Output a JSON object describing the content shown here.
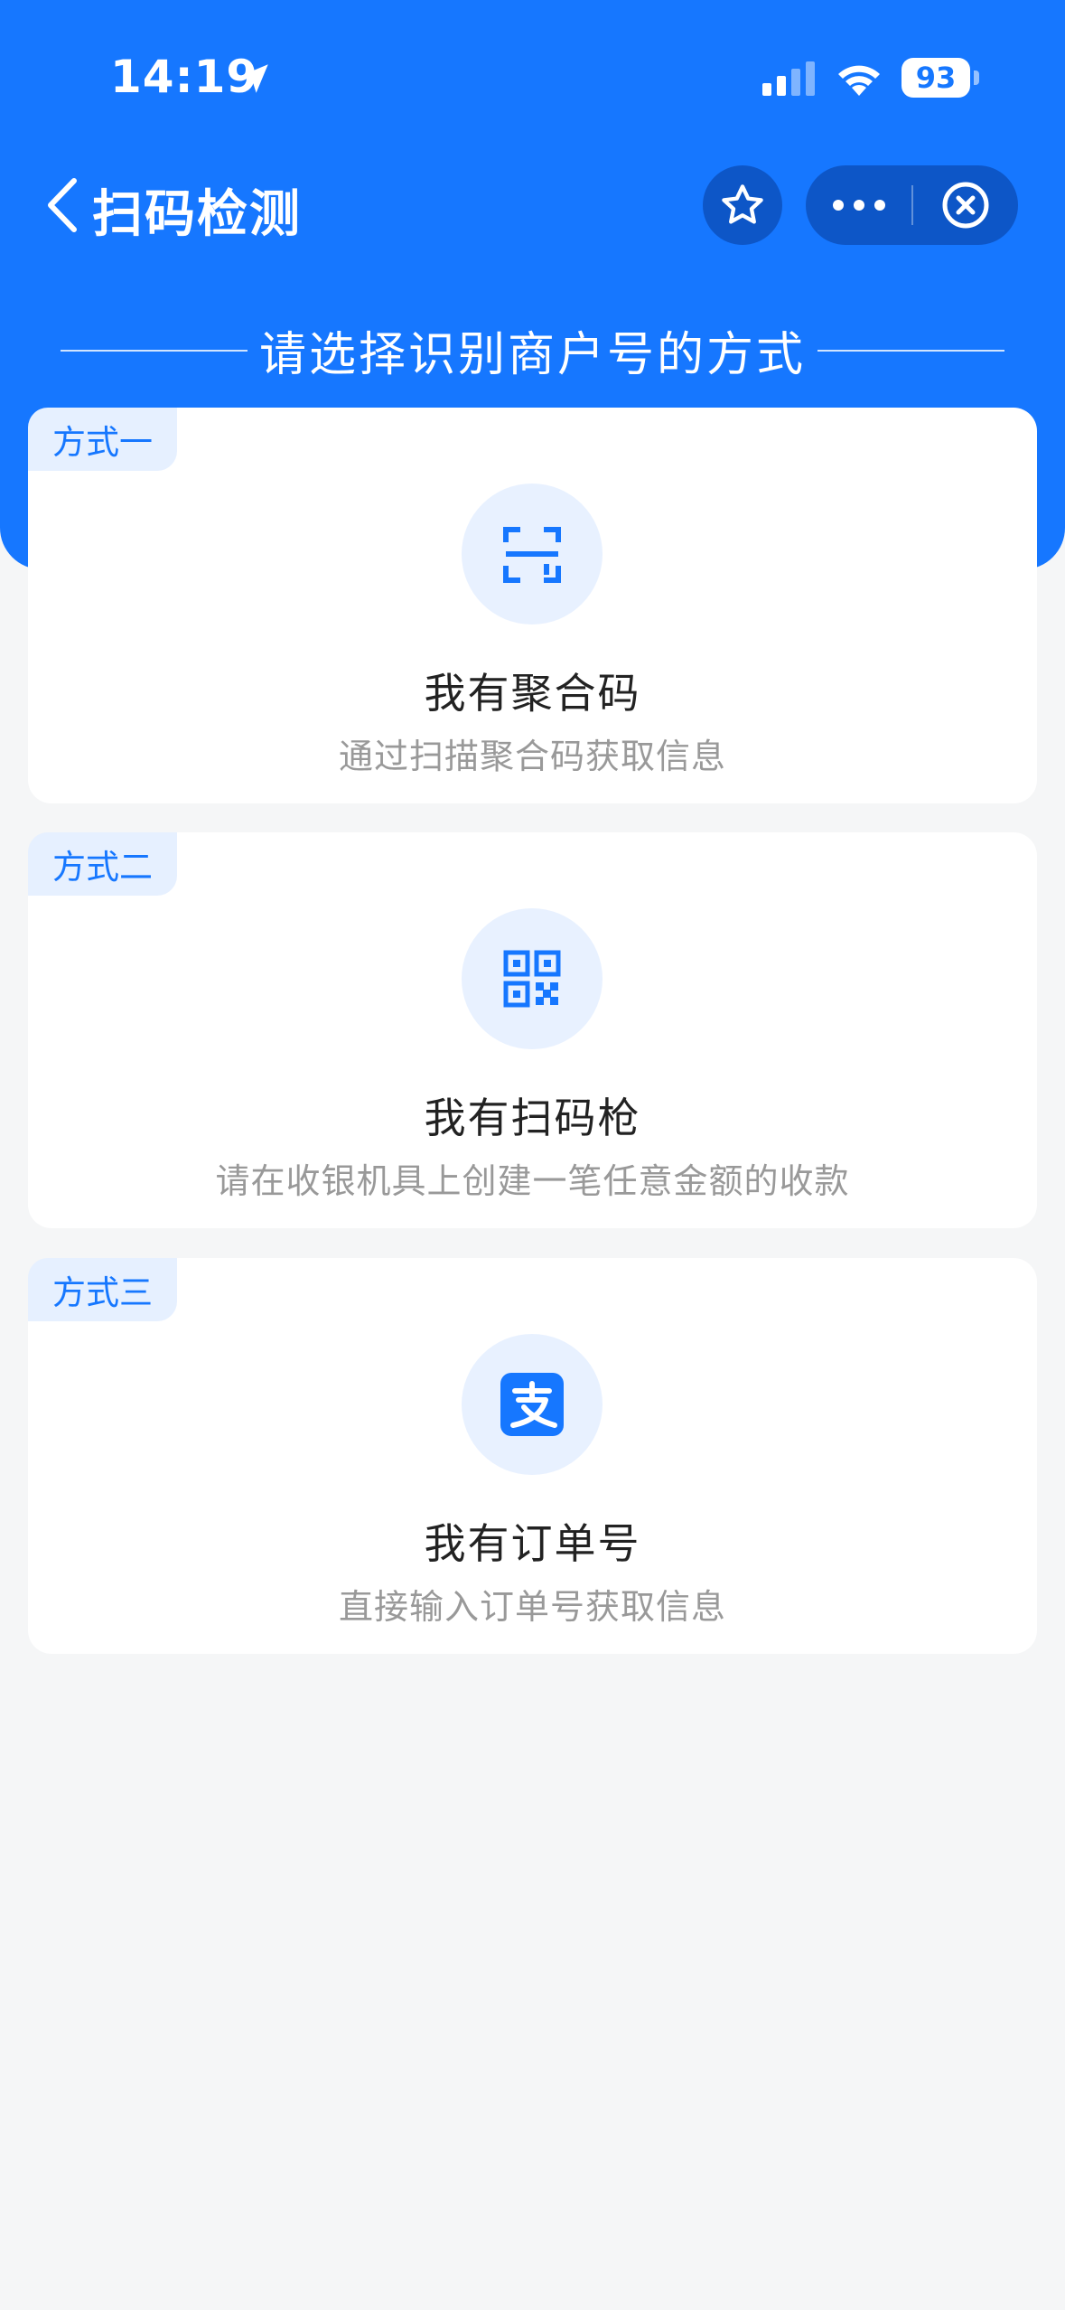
{
  "status_bar": {
    "time": "14:19",
    "battery": "93",
    "icons": [
      "location-arrow-icon",
      "cellular-signal-icon",
      "wifi-icon",
      "battery-icon"
    ]
  },
  "nav": {
    "title": "扫码检测",
    "icons": [
      "back-chevron-icon",
      "star-icon",
      "more-dots-icon",
      "close-circle-icon"
    ]
  },
  "heading": "请选择识别商户号的方式",
  "options": [
    {
      "tag": "方式一",
      "title": "我有聚合码",
      "desc": "通过扫描聚合码获取信息",
      "icon": "scan-frame-icon"
    },
    {
      "tag": "方式二",
      "title": "我有扫码枪",
      "desc": "请在收银机具上创建一笔任意金额的收款",
      "icon": "qr-code-icon"
    },
    {
      "tag": "方式三",
      "title": "我有订单号",
      "desc": "直接输入订单号获取信息",
      "icon": "alipay-icon"
    }
  ],
  "colors": {
    "primary": "#1677ff",
    "primary_dark": "#0d56c7",
    "tag_bg": "#e6f0ff",
    "icon_bg": "#e8f1ff",
    "page_bg": "#f5f6f7",
    "title_text": "#222222",
    "desc_text": "#999999"
  }
}
